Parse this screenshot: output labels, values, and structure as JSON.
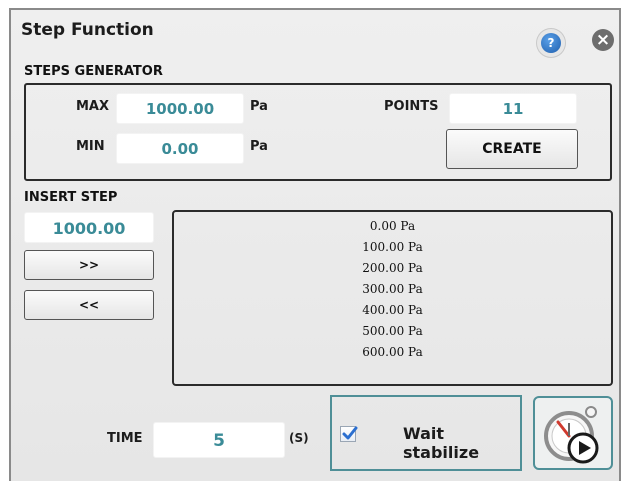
{
  "title": "Step Function",
  "help_icon_glyph": "?",
  "close_icon_glyph": "×",
  "steps_generator": {
    "section_label": "STEPS GENERATOR",
    "max_label": "MAX",
    "max_value": "1000.00",
    "max_unit": "Pa",
    "min_label": "MIN",
    "min_value": "0.00",
    "min_unit": "Pa",
    "points_label": "POINTS",
    "points_value": "11",
    "create_label": "CREATE"
  },
  "insert_step": {
    "section_label": "INSERT STEP",
    "value": "1000.00",
    "add_label": ">>",
    "remove_label": "<<"
  },
  "steps_list": [
    "0.00 Pa",
    "100.00 Pa",
    "200.00 Pa",
    "300.00 Pa",
    "400.00 Pa",
    "500.00 Pa",
    "600.00 Pa"
  ],
  "time": {
    "label": "TIME",
    "value": "5",
    "unit": "(S)"
  },
  "wait_stabilize": {
    "label": "Wait stabilize",
    "checked": true
  },
  "colors": {
    "field_text": "#3a8b97",
    "accent_border": "#4f8f97",
    "help_icon": "#1f5fae"
  },
  "icons": {
    "help": "help-icon",
    "close": "close-icon",
    "checkbox": "checkmark-icon",
    "start": "stopwatch-play-icon"
  }
}
